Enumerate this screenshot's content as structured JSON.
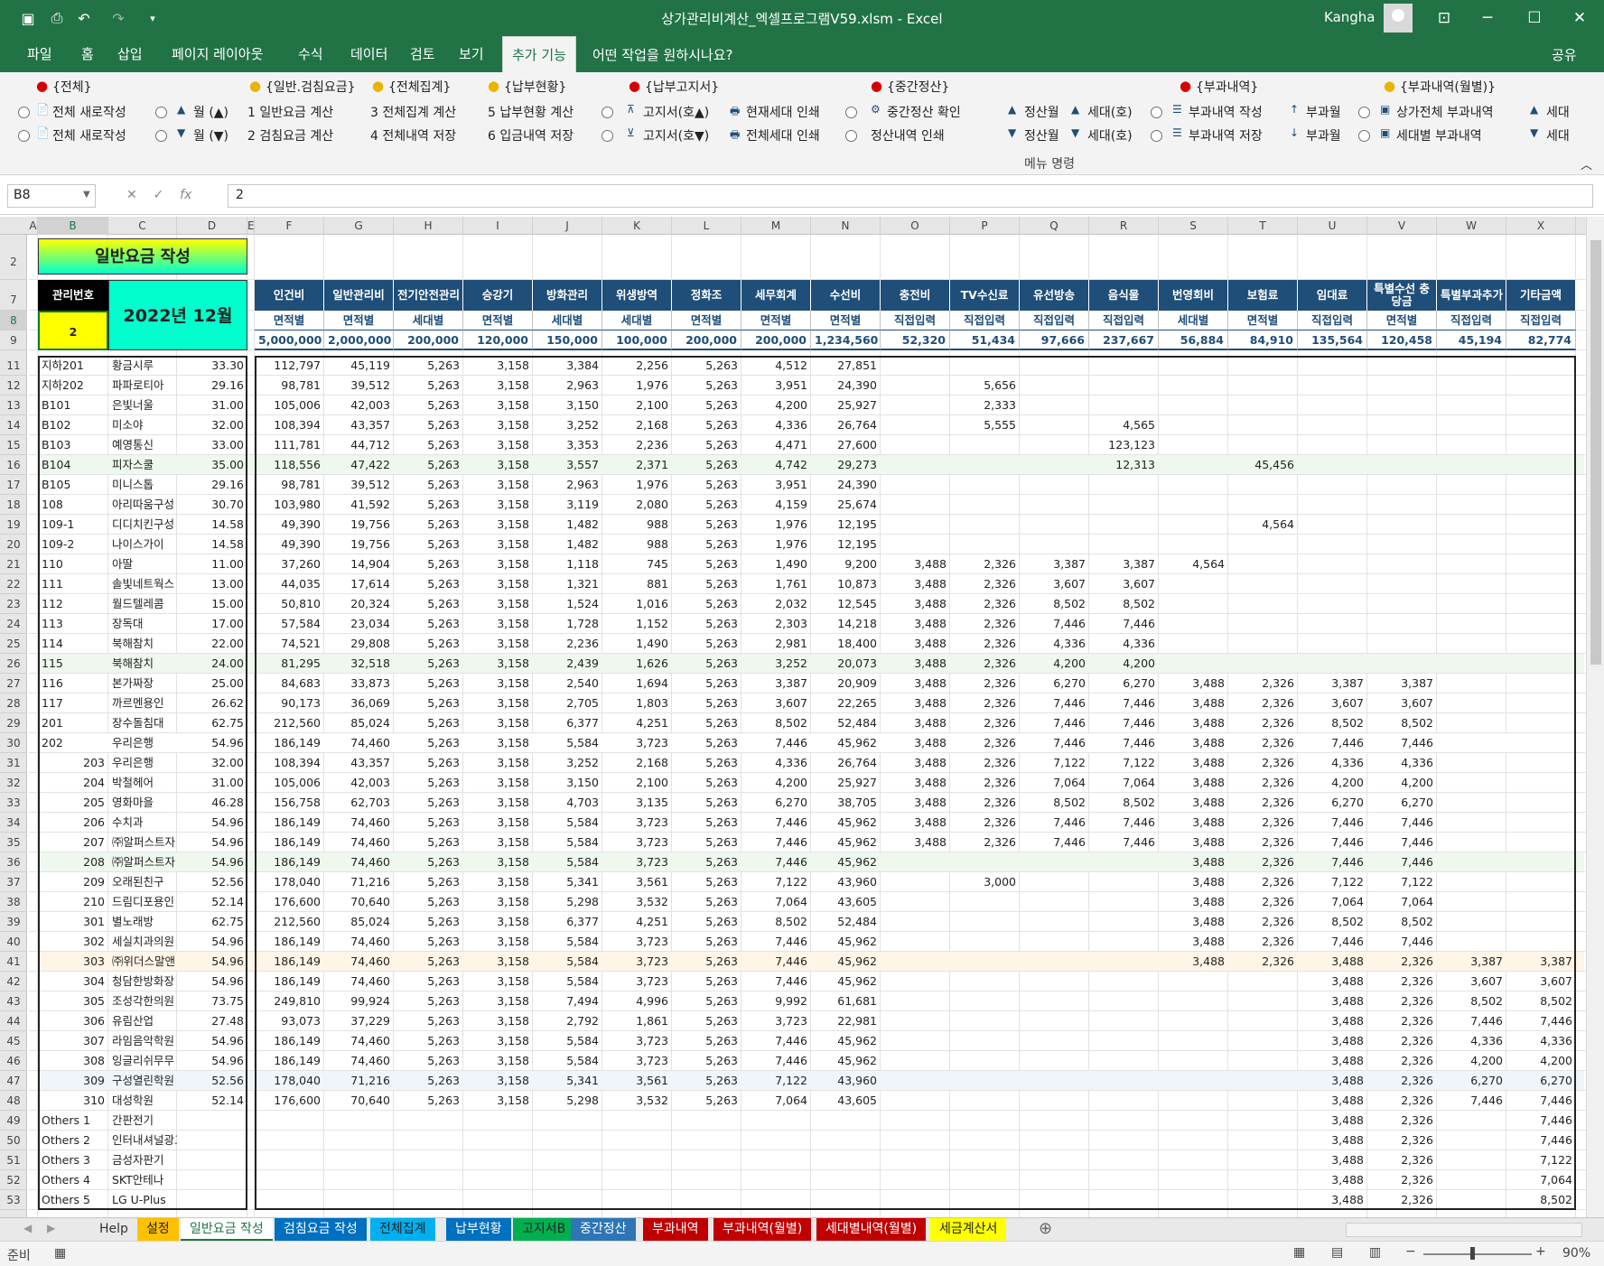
{
  "titlebar": {
    "title": "상가관리비계산_엑셀프로그램V59.xlsm  -  Excel",
    "user": "Kangha"
  },
  "menu": [
    "파일",
    "홈",
    "삽입",
    "페이지 레이아웃",
    "수식",
    "데이터",
    "검토",
    "보기",
    "추가 기능"
  ],
  "tell_me": "어떤 작업을 원하시나요?",
  "share": "공유",
  "ribbon": {
    "group_label": "메뉴 명령",
    "groups": [
      "{전체}",
      "{일반.검침요금}",
      "{전체집계}",
      "{납부현황}",
      "{납부고지서}",
      "{중간정산}",
      "{부과내역}",
      "{부과내역(월별)}"
    ],
    "row1": [
      "전체 새로작성",
      "월 (▲)",
      "1 일반요금 계산",
      "3 전체집계 계산",
      "5 납부현황 계산",
      "고지서(호▲)",
      "현재세대 인쇄",
      "중간정산 확인",
      "정산월",
      "세대(호)",
      "부과내역 작성",
      "부과월",
      "상가전체 부과내역",
      "세대"
    ],
    "row2": [
      "전체 새로작성",
      "월 (▼)",
      "2 검침요금 계산",
      "4 전체내역 저장",
      "6 입금내역 저장",
      "고지서(호▼)",
      "전체세대 인쇄",
      "정산내역 인쇄",
      "정산월",
      "세대(호)",
      "부과내역 저장",
      "부과월",
      "세대별 부과내역",
      "세대"
    ]
  },
  "formula": {
    "name_box": "B8",
    "content": "2"
  },
  "columns": [
    "A",
    "B",
    "C",
    "D",
    "E",
    "F",
    "G",
    "H",
    "I",
    "J",
    "K",
    "L",
    "M",
    "N",
    "O",
    "P",
    "Q",
    "R",
    "S",
    "T",
    "U",
    "V",
    "W",
    "X"
  ],
  "sheet": {
    "title": "일반요금 작성",
    "mgmt_label": "관리번호",
    "mgmt_value": "2",
    "period": "2022년 12월",
    "headers": [
      "인건비",
      "일반관리비",
      "전기안전관리",
      "승강기",
      "방화관리",
      "위생방역",
      "정화조",
      "세무회계",
      "수선비",
      "충전비",
      "TV수신료",
      "유선방송",
      "음식물",
      "번영회비",
      "보험료",
      "임대료",
      "특별수선 충당금",
      "특별부과추가",
      "기타금액"
    ],
    "types": [
      "면적별",
      "면적별",
      "세대별",
      "면적별",
      "세대별",
      "세대별",
      "면적별",
      "면적별",
      "면적별",
      "직접입력",
      "직접입력",
      "직접입력",
      "직접입력",
      "세대별",
      "면적별",
      "직접입력",
      "면적별",
      "직접입력",
      "직접입력"
    ],
    "totals": [
      "5,000,000",
      "2,000,000",
      "200,000",
      "120,000",
      "150,000",
      "100,000",
      "200,000",
      "200,000",
      "1,234,560",
      "52,320",
      "51,434",
      "97,666",
      "237,667",
      "56,884",
      "84,910",
      "135,564",
      "120,458",
      "45,194",
      "82,774"
    ],
    "rows": [
      [
        "지하201",
        "황금시루",
        "33.30",
        "112,797",
        "45,119",
        "5,263",
        "3,158",
        "3,384",
        "2,256",
        "5,263",
        "4,512",
        "27,851",
        "",
        "",
        "",
        "",
        "",
        "",
        "",
        "",
        "",
        ""
      ],
      [
        "지하202",
        "파파로티아",
        "29.16",
        "98,781",
        "39,512",
        "5,263",
        "3,158",
        "2,963",
        "1,976",
        "5,263",
        "3,951",
        "24,390",
        "",
        "5,656",
        "",
        "",
        "",
        "",
        "",
        "",
        "",
        ""
      ],
      [
        "B101",
        "은빛너울",
        "31.00",
        "105,006",
        "42,003",
        "5,263",
        "3,158",
        "3,150",
        "2,100",
        "5,263",
        "4,200",
        "25,927",
        "",
        "2,333",
        "",
        "",
        "",
        "",
        "",
        "",
        "",
        ""
      ],
      [
        "B102",
        "미소야",
        "32.00",
        "108,394",
        "43,357",
        "5,263",
        "3,158",
        "3,252",
        "2,168",
        "5,263",
        "4,336",
        "26,764",
        "",
        "5,555",
        "",
        "4,565",
        "",
        "",
        "",
        "",
        "",
        ""
      ],
      [
        "B103",
        "예영통신",
        "33.00",
        "111,781",
        "44,712",
        "5,263",
        "3,158",
        "3,353",
        "2,236",
        "5,263",
        "4,471",
        "27,600",
        "",
        "",
        "",
        "123,123",
        "",
        "",
        "",
        "",
        "",
        ""
      ],
      [
        "B104",
        "피자스쿨",
        "35.00",
        "118,556",
        "47,422",
        "5,263",
        "3,158",
        "3,557",
        "2,371",
        "5,263",
        "4,742",
        "29,273",
        "",
        "",
        "",
        "12,313",
        "",
        "45,456",
        "",
        "",
        "",
        ""
      ],
      [
        "B105",
        "미니스톱",
        "29.16",
        "98,781",
        "39,512",
        "5,263",
        "3,158",
        "2,963",
        "1,976",
        "5,263",
        "3,951",
        "24,390",
        "",
        "",
        "",
        "",
        "",
        "",
        "",
        "",
        "",
        ""
      ],
      [
        "108",
        "아리따움구성",
        "30.70",
        "103,980",
        "41,592",
        "5,263",
        "3,158",
        "3,119",
        "2,080",
        "5,263",
        "4,159",
        "25,674",
        "",
        "",
        "",
        "",
        "",
        "",
        "",
        "",
        "",
        ""
      ],
      [
        "109-1",
        "디디치킨구성",
        "14.58",
        "49,390",
        "19,756",
        "5,263",
        "3,158",
        "1,482",
        "988",
        "5,263",
        "1,976",
        "12,195",
        "",
        "",
        "",
        "",
        "",
        "4,564",
        "",
        "",
        "",
        ""
      ],
      [
        "109-2",
        "나이스가이",
        "14.58",
        "49,390",
        "19,756",
        "5,263",
        "3,158",
        "1,482",
        "988",
        "5,263",
        "1,976",
        "12,195",
        "",
        "",
        "",
        "",
        "",
        "",
        "",
        "",
        "",
        ""
      ],
      [
        "110",
        "아딸",
        "11.00",
        "37,260",
        "14,904",
        "5,263",
        "3,158",
        "1,118",
        "745",
        "5,263",
        "1,490",
        "9,200",
        "3,488",
        "2,326",
        "3,387",
        "3,387",
        "4,564",
        "",
        "",
        "",
        "",
        ""
      ],
      [
        "111",
        "솔빛네트웍스",
        "13.00",
        "44,035",
        "17,614",
        "5,263",
        "3,158",
        "1,321",
        "881",
        "5,263",
        "1,761",
        "10,873",
        "3,488",
        "2,326",
        "3,607",
        "3,607",
        "",
        "",
        "",
        "",
        "",
        ""
      ],
      [
        "112",
        "월드텔레콤",
        "15.00",
        "50,810",
        "20,324",
        "5,263",
        "3,158",
        "1,524",
        "1,016",
        "5,263",
        "2,032",
        "12,545",
        "3,488",
        "2,326",
        "8,502",
        "8,502",
        "",
        "",
        "",
        "",
        "",
        ""
      ],
      [
        "113",
        "장독대",
        "17.00",
        "57,584",
        "23,034",
        "5,263",
        "3,158",
        "1,728",
        "1,152",
        "5,263",
        "2,303",
        "14,218",
        "3,488",
        "2,326",
        "7,446",
        "7,446",
        "",
        "",
        "",
        "",
        "",
        ""
      ],
      [
        "114",
        "북해참치",
        "22.00",
        "74,521",
        "29,808",
        "5,263",
        "3,158",
        "2,236",
        "1,490",
        "5,263",
        "2,981",
        "18,400",
        "3,488",
        "2,326",
        "4,336",
        "4,336",
        "",
        "",
        "",
        "",
        "",
        ""
      ],
      [
        "115",
        "북해참치",
        "24.00",
        "81,295",
        "32,518",
        "5,263",
        "3,158",
        "2,439",
        "1,626",
        "5,263",
        "3,252",
        "20,073",
        "3,488",
        "2,326",
        "4,200",
        "4,200",
        "",
        "",
        "",
        "",
        "",
        ""
      ],
      [
        "116",
        "본가짜장",
        "25.00",
        "84,683",
        "33,873",
        "5,263",
        "3,158",
        "2,540",
        "1,694",
        "5,263",
        "3,387",
        "20,909",
        "3,488",
        "2,326",
        "6,270",
        "6,270",
        "3,488",
        "2,326",
        "3,387",
        "3,387",
        "",
        ""
      ],
      [
        "117",
        "까르멘용인",
        "26.62",
        "90,173",
        "36,069",
        "5,263",
        "3,158",
        "2,705",
        "1,803",
        "5,263",
        "3,607",
        "22,265",
        "3,488",
        "2,326",
        "7,446",
        "7,446",
        "3,488",
        "2,326",
        "3,607",
        "3,607",
        "",
        ""
      ],
      [
        "201",
        "장수돌침대",
        "62.75",
        "212,560",
        "85,024",
        "5,263",
        "3,158",
        "6,377",
        "4,251",
        "5,263",
        "8,502",
        "52,484",
        "3,488",
        "2,326",
        "7,446",
        "7,446",
        "3,488",
        "2,326",
        "8,502",
        "8,502",
        "",
        ""
      ],
      [
        "202",
        "우리은행",
        "54.96",
        "186,149",
        "74,460",
        "5,263",
        "3,158",
        "5,584",
        "3,723",
        "5,263",
        "7,446",
        "45,962",
        "3,488",
        "2,326",
        "7,446",
        "7,446",
        "3,488",
        "2,326",
        "7,446",
        "7,446",
        "",
        ""
      ],
      [
        "203",
        "우리은행",
        "32.00",
        "108,394",
        "43,357",
        "5,263",
        "3,158",
        "3,252",
        "2,168",
        "5,263",
        "4,336",
        "26,764",
        "3,488",
        "2,326",
        "7,122",
        "7,122",
        "3,488",
        "2,326",
        "4,336",
        "4,336",
        "",
        ""
      ],
      [
        "204",
        "박철헤어",
        "31.00",
        "105,006",
        "42,003",
        "5,263",
        "3,158",
        "3,150",
        "2,100",
        "5,263",
        "4,200",
        "25,927",
        "3,488",
        "2,326",
        "7,064",
        "7,064",
        "3,488",
        "2,326",
        "4,200",
        "4,200",
        "",
        ""
      ],
      [
        "205",
        "영화마을",
        "46.28",
        "156,758",
        "62,703",
        "5,263",
        "3,158",
        "4,703",
        "3,135",
        "5,263",
        "6,270",
        "38,705",
        "3,488",
        "2,326",
        "8,502",
        "8,502",
        "3,488",
        "2,326",
        "6,270",
        "6,270",
        "",
        ""
      ],
      [
        "206",
        "수치과",
        "54.96",
        "186,149",
        "74,460",
        "5,263",
        "3,158",
        "5,584",
        "3,723",
        "5,263",
        "7,446",
        "45,962",
        "3,488",
        "2,326",
        "7,446",
        "7,446",
        "3,488",
        "2,326",
        "7,446",
        "7,446",
        "",
        ""
      ],
      [
        "207",
        "㈜알퍼스트자",
        "54.96",
        "186,149",
        "74,460",
        "5,263",
        "3,158",
        "5,584",
        "3,723",
        "5,263",
        "7,446",
        "45,962",
        "3,488",
        "2,326",
        "7,446",
        "7,446",
        "3,488",
        "2,326",
        "7,446",
        "7,446",
        "",
        ""
      ],
      [
        "208",
        "㈜알퍼스트자",
        "54.96",
        "186,149",
        "74,460",
        "5,263",
        "3,158",
        "5,584",
        "3,723",
        "5,263",
        "7,446",
        "45,962",
        "",
        "",
        "",
        "",
        "3,488",
        "2,326",
        "7,446",
        "7,446",
        "",
        ""
      ],
      [
        "209",
        "오래된친구",
        "52.56",
        "178,040",
        "71,216",
        "5,263",
        "3,158",
        "5,341",
        "3,561",
        "5,263",
        "7,122",
        "43,960",
        "",
        "3,000",
        "",
        "",
        "3,488",
        "2,326",
        "7,122",
        "7,122",
        "",
        ""
      ],
      [
        "210",
        "드림디포용인",
        "52.14",
        "176,600",
        "70,640",
        "5,263",
        "3,158",
        "5,298",
        "3,532",
        "5,263",
        "7,064",
        "43,605",
        "",
        "",
        "",
        "",
        "3,488",
        "2,326",
        "7,064",
        "7,064",
        "",
        ""
      ],
      [
        "301",
        "별노래방",
        "62.75",
        "212,560",
        "85,024",
        "5,263",
        "3,158",
        "6,377",
        "4,251",
        "5,263",
        "8,502",
        "52,484",
        "",
        "",
        "",
        "",
        "3,488",
        "2,326",
        "8,502",
        "8,502",
        "",
        ""
      ],
      [
        "302",
        "세실치과의원",
        "54.96",
        "186,149",
        "74,460",
        "5,263",
        "3,158",
        "5,584",
        "3,723",
        "5,263",
        "7,446",
        "45,962",
        "",
        "",
        "",
        "",
        "3,488",
        "2,326",
        "7,446",
        "7,446",
        "",
        ""
      ],
      [
        "303",
        "㈜위더스말앤",
        "54.96",
        "186,149",
        "74,460",
        "5,263",
        "3,158",
        "5,584",
        "3,723",
        "5,263",
        "7,446",
        "45,962",
        "",
        "",
        "",
        "",
        "3,488",
        "2,326",
        "3,488",
        "2,326",
        "3,387",
        "3,387"
      ],
      [
        "304",
        "청담한방화장",
        "54.96",
        "186,149",
        "74,460",
        "5,263",
        "3,158",
        "5,584",
        "3,723",
        "5,263",
        "7,446",
        "45,962",
        "",
        "",
        "",
        "",
        "",
        "",
        "3,488",
        "2,326",
        "3,607",
        "3,607"
      ],
      [
        "305",
        "조성각한의원",
        "73.75",
        "249,810",
        "99,924",
        "5,263",
        "3,158",
        "7,494",
        "4,996",
        "5,263",
        "9,992",
        "61,681",
        "",
        "",
        "",
        "",
        "",
        "",
        "3,488",
        "2,326",
        "8,502",
        "8,502"
      ],
      [
        "306",
        "유림산업",
        "27.48",
        "93,073",
        "37,229",
        "5,263",
        "3,158",
        "2,792",
        "1,861",
        "5,263",
        "3,723",
        "22,981",
        "",
        "",
        "",
        "",
        "",
        "",
        "3,488",
        "2,326",
        "7,446",
        "7,446"
      ],
      [
        "307",
        "라임음악학원",
        "54.96",
        "186,149",
        "74,460",
        "5,263",
        "3,158",
        "5,584",
        "3,723",
        "5,263",
        "7,446",
        "45,962",
        "",
        "",
        "",
        "",
        "",
        "",
        "3,488",
        "2,326",
        "4,336",
        "4,336"
      ],
      [
        "308",
        "잉글리쉬무무",
        "54.96",
        "186,149",
        "74,460",
        "5,263",
        "3,158",
        "5,584",
        "3,723",
        "5,263",
        "7,446",
        "45,962",
        "",
        "",
        "",
        "",
        "",
        "",
        "3,488",
        "2,326",
        "4,200",
        "4,200"
      ],
      [
        "309",
        "구성열린학원",
        "52.56",
        "178,040",
        "71,216",
        "5,263",
        "3,158",
        "5,341",
        "3,561",
        "5,263",
        "7,122",
        "43,960",
        "",
        "",
        "",
        "",
        "",
        "",
        "3,488",
        "2,326",
        "6,270",
        "6,270"
      ],
      [
        "310",
        "대성학원",
        "52.14",
        "176,600",
        "70,640",
        "5,263",
        "3,158",
        "5,298",
        "3,532",
        "5,263",
        "7,064",
        "43,605",
        "",
        "",
        "",
        "",
        "",
        "",
        "3,488",
        "2,326",
        "7,446",
        "7,446"
      ],
      [
        "Others 1",
        "간판전기",
        "",
        "",
        "",
        "",
        "",
        "",
        "",
        "",
        "",
        "",
        "",
        "",
        "",
        "",
        "",
        "",
        "3,488",
        "2,326",
        "",
        "7,446"
      ],
      [
        "Others 2",
        "인터내셔널광고",
        "",
        "",
        "",
        "",
        "",
        "",
        "",
        "",
        "",
        "",
        "",
        "",
        "",
        "",
        "",
        "",
        "3,488",
        "2,326",
        "",
        "7,446"
      ],
      [
        "Others 3",
        "금성자판기",
        "",
        "",
        "",
        "",
        "",
        "",
        "",
        "",
        "",
        "",
        "",
        "",
        "",
        "",
        "",
        "",
        "3,488",
        "2,326",
        "",
        "7,122"
      ],
      [
        "Others 4",
        "SKT안테나",
        "",
        "",
        "",
        "",
        "",
        "",
        "",
        "",
        "",
        "",
        "",
        "",
        "",
        "",
        "",
        "",
        "3,488",
        "2,326",
        "",
        "7,064"
      ],
      [
        "Others 5",
        "LG U-Plus",
        "",
        "",
        "",
        "",
        "",
        "",
        "",
        "",
        "",
        "",
        "",
        "",
        "",
        "",
        "",
        "",
        "3,488",
        "2,326",
        "",
        "8,502"
      ]
    ]
  },
  "sheet_tabs": [
    {
      "label": "Help",
      "color": "#e9e9e9",
      "text": "#333"
    },
    {
      "label": "설정",
      "color": "#ffc000",
      "text": "#222"
    },
    {
      "label": "일반요금 작성",
      "color": "#ffffff",
      "text": "#217346"
    },
    {
      "label": "검침요금 작성",
      "color": "#0070c0",
      "text": "#fff"
    },
    {
      "label": "전체집계",
      "color": "#00b0f0",
      "text": "#222"
    },
    {
      "label": "납부현황",
      "color": "#0070c0",
      "text": "#fff"
    },
    {
      "label": "고지서B",
      "color": "#00b050",
      "text": "#222"
    },
    {
      "label": "중간정산",
      "color": "#2e75b6",
      "text": "#fff"
    },
    {
      "label": "부과내역",
      "color": "#c00000",
      "text": "#fff"
    },
    {
      "label": "부과내역(월별)",
      "color": "#c00000",
      "text": "#fff"
    },
    {
      "label": "세대별내역(월별)",
      "color": "#c00000",
      "text": "#fff"
    },
    {
      "label": "세금계산서",
      "color": "#ffff00",
      "text": "#222"
    }
  ],
  "status": {
    "ready": "준비",
    "zoom": "90%"
  },
  "colors": {
    "excel_green": "#217346",
    "header_blue": "#1f4e79",
    "title_yellow": "#ffff00",
    "title_cyan": "#00ffcc"
  }
}
